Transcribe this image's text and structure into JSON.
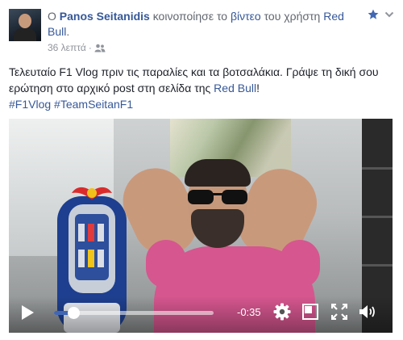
{
  "post": {
    "headline": {
      "prefix": "Ο",
      "author": "Panos Seitanidis",
      "verb": "κοινοποίησε το",
      "object": "βίντεο",
      "suffix": "του χρήστη",
      "page": "Red Bull",
      "period": "."
    },
    "time_ago": "36 λεπτά",
    "separator": "·",
    "audience_icon": "friends-icon",
    "text": {
      "part1": "Τελευταίο F1 Vlog πριν τις παραλίες και τα βοτσαλάκια. Γράψε τη δική σου ερώτηση στο αρχικό post στη σελίδα της",
      "link": "Red Bull",
      "part2": "!"
    },
    "hashtags": [
      "#F1Vlog",
      "#TeamSeitanF1"
    ],
    "header_icons": [
      "star-icon",
      "chevron-down-icon"
    ]
  },
  "video": {
    "progress": 0.12,
    "remaining": "-0:35",
    "controls": [
      "play-icon",
      "gear-icon",
      "picture-in-picture-icon",
      "fullscreen-icon",
      "volume-icon"
    ],
    "accent_color": "#4267b2"
  },
  "colors": {
    "link": "#365899",
    "text": "#1d2129",
    "muted": "#90949c",
    "shirt": "#d6568f"
  }
}
